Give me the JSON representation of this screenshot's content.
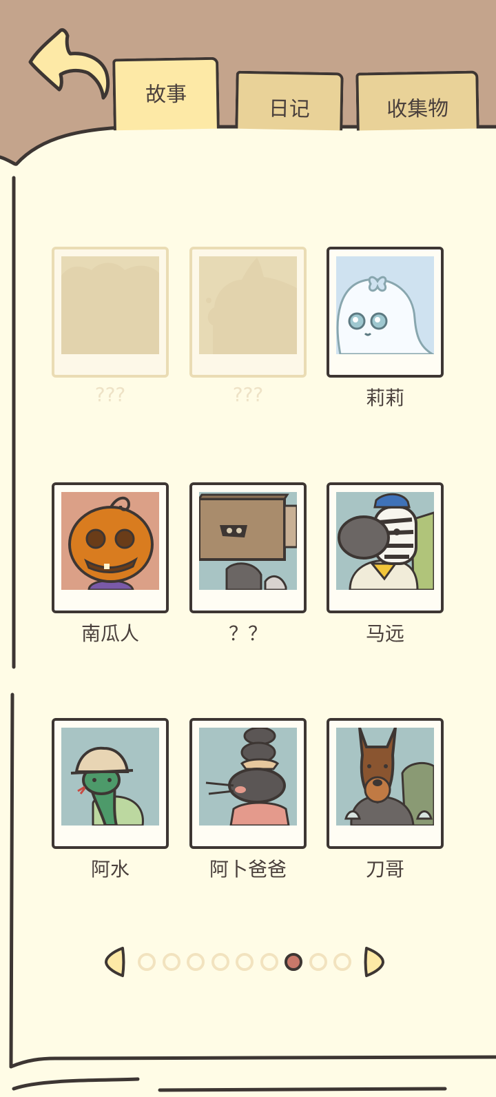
{
  "tabs": [
    {
      "id": "story",
      "label": "故事",
      "active": true
    },
    {
      "id": "diary",
      "label": "日记",
      "active": false
    },
    {
      "id": "collect",
      "label": "收集物",
      "active": false
    }
  ],
  "characters": [
    {
      "name": "???",
      "locked": true,
      "icon": "locked-silhouette-icon"
    },
    {
      "name": "???",
      "locked": true,
      "icon": "locked-silhouette-icon"
    },
    {
      "name": "莉莉",
      "locked": false,
      "icon": "ghost-with-bow-icon"
    },
    {
      "name": "南瓜人",
      "locked": false,
      "icon": "pumpkin-head-icon"
    },
    {
      "name": "？？",
      "locked": false,
      "icon": "box-head-icon"
    },
    {
      "name": "马远",
      "locked": false,
      "icon": "zebra-icon"
    },
    {
      "name": "阿水",
      "locked": false,
      "icon": "snake-with-hat-icon"
    },
    {
      "name": "阿卜爸爸",
      "locked": false,
      "icon": "rat-stack-icon"
    },
    {
      "name": "刀哥",
      "locked": false,
      "icon": "doberman-icon"
    }
  ],
  "pagination": {
    "total_pages": 9,
    "current_page": 7
  },
  "colors": {
    "background": "#c4a48c",
    "page": "#fffce6",
    "ink": "#3d3633",
    "tab_active": "#fde9a6",
    "tab_inactive": "#e9d298",
    "dot_active": "#c8786a",
    "dot_inactive": "#f2e3bf"
  }
}
